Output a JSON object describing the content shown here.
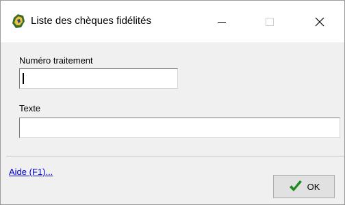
{
  "window": {
    "title": "Liste des chèques fidélités",
    "min_symbol": "—",
    "close_symbol": "✕",
    "icon": "app-icon"
  },
  "form": {
    "numero_label": "Numéro traitement",
    "numero_value": "",
    "texte_label": "Texte",
    "texte_value": ""
  },
  "footer": {
    "help_label": "Aide (F1)...",
    "ok_label": "OK",
    "ok_icon": "check-icon"
  },
  "colors": {
    "link": "#0000cc",
    "check": "#1f8a1f"
  }
}
